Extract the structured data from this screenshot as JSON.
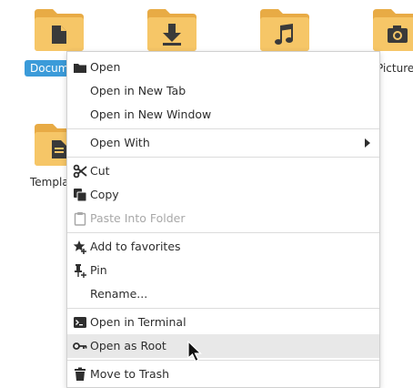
{
  "folders": [
    {
      "label": "Docum",
      "selected": true,
      "icon": "document-icon"
    },
    {
      "label": "",
      "icon": "download-icon"
    },
    {
      "label": "",
      "icon": "music-icon"
    },
    {
      "label": "Picture",
      "icon": "camera-icon"
    },
    {
      "label": "Templa",
      "icon": "template-icon"
    }
  ],
  "menu": {
    "open": "Open",
    "open_new_tab": "Open in New Tab",
    "open_new_window": "Open in New Window",
    "open_with": "Open With",
    "cut": "Cut",
    "copy": "Copy",
    "paste_into_folder": "Paste Into Folder",
    "add_to_favorites": "Add to favorites",
    "pin": "Pin",
    "rename": "Rename...",
    "open_in_terminal": "Open in Terminal",
    "open_as_root": "Open as Root",
    "move_to_trash": "Move to Trash"
  },
  "colors": {
    "folder_body": "#f6c667",
    "folder_tab": "#e8ab45",
    "folder_glyph": "#3a3a3a",
    "selection": "#3b9bd9",
    "hover": "#e8e8e8"
  }
}
